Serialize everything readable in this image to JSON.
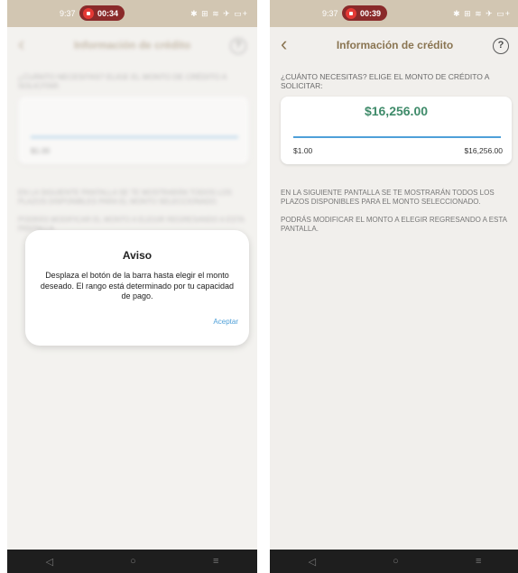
{
  "status_bar": {
    "left_time": "9:37",
    "left_recording": "00:34",
    "right_time": "9:37",
    "right_recording": "00:39",
    "icons": "✱ ⊞ ≋ ✈ ▭+"
  },
  "header": {
    "back_icon": "‹",
    "title": "Información de crédito",
    "help_icon": "?"
  },
  "credit": {
    "question": "¿CUÁNTO NECESITAS? ELIGE EL MONTO DE CRÉDITO A SOLICITAR:",
    "amount": "$16,256.00",
    "min": "$1.00",
    "max": "$16,256.00",
    "info1": "EN LA SIGUIENTE PANTALLA SE TE MOSTRARÁN TODOS LOS PLAZOS DISPONIBLES PARA EL MONTO SELECCIONADO.",
    "info2": "PODRÁS MODIFICAR EL MONTO A ELEGIR REGRESANDO A ESTA PANTALLA."
  },
  "dialog": {
    "title": "Aviso",
    "message": "Desplaza el botón de la barra hasta elegir el monto deseado. El rango está determinado por tu capacidad de pago.",
    "accept": "Aceptar"
  },
  "nav": {
    "back": "◁",
    "home": "○",
    "menu": "≡"
  },
  "colors": {
    "accent": "#8a7552",
    "amount": "#3f8b6a",
    "link": "#4fa0d8",
    "status_bar": "#d2c6b2"
  }
}
